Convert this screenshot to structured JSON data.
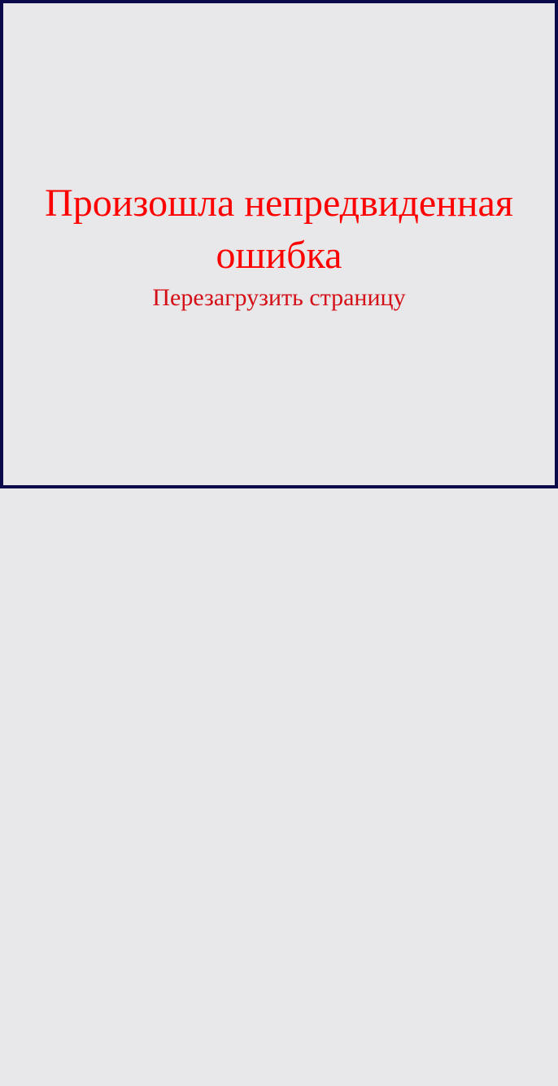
{
  "error": {
    "title": "Произошла непредвиденная ошибка",
    "reload_label": "Перезагрузить страницу"
  },
  "colors": {
    "background": "#e8e7e9",
    "border": "#0a0a4a",
    "title": "#ff0000",
    "link": "#d40f17"
  }
}
